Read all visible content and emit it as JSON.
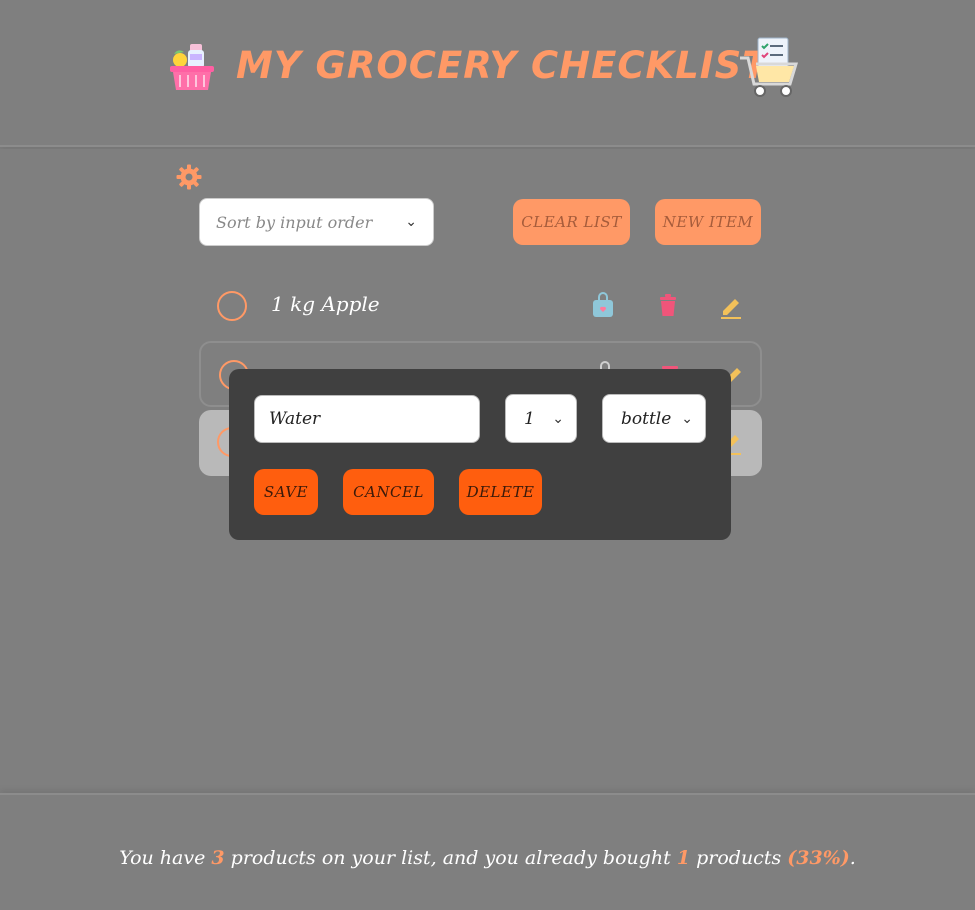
{
  "header": {
    "title": "MY GROCERY CHECKLIST",
    "left_icon": "grocery-basket-icon",
    "right_icon": "shopping-cart-checklist-icon"
  },
  "toolbar": {
    "settings_icon": "gear-icon",
    "sort_value": "Sort by input order",
    "clear_label": "CLEAR LIST",
    "new_label": "NEW ITEM"
  },
  "list": {
    "items": [
      {
        "text": "1 kg Apple"
      },
      {
        "text": ""
      },
      {
        "text": ""
      }
    ]
  },
  "modal": {
    "name_value": "Water",
    "quantity_value": "1",
    "unit_value": "bottle",
    "save_label": "SAVE",
    "cancel_label": "CANCEL",
    "delete_label": "DELETE"
  },
  "footer": {
    "prefix": "You have ",
    "total_count": "3",
    "middle": " products on your list, and you already bought ",
    "bought_count": "1",
    "suffix_products": " products ",
    "percent": "(33%)",
    "end": "."
  },
  "colors": {
    "accent": "#ff9966",
    "modal_button": "#ff5e0e",
    "background": "#7f7f7f",
    "modal_bg": "#404040"
  }
}
